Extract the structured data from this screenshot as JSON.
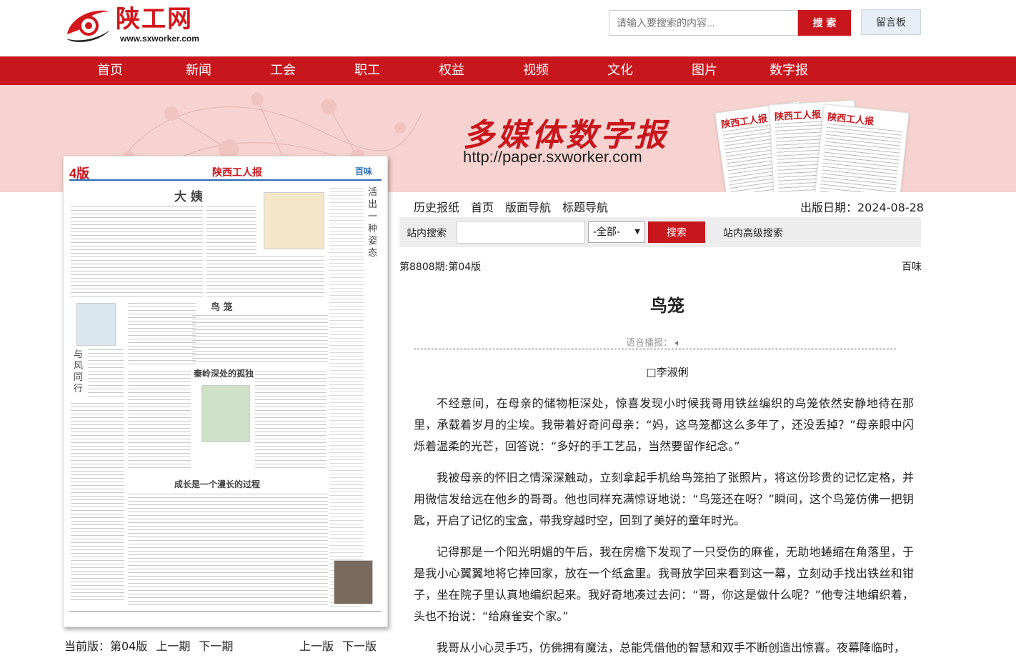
{
  "header": {
    "logo_text": "陕工网",
    "logo_url": "www.sxworker.com",
    "search_placeholder": "请输入要搜索的内容...",
    "search_button": "搜 索",
    "guestbook_button": "留言板"
  },
  "nav": {
    "items": [
      "首页",
      "新闻",
      "工会",
      "职工",
      "权益",
      "视频",
      "文化",
      "图片",
      "数字报"
    ]
  },
  "banner": {
    "title": "多媒体数字报",
    "url": "http://paper.sxworker.com",
    "paper_masthead": "陕西工人报"
  },
  "newspaper": {
    "page_number": "4版",
    "masthead": "陕西工人报",
    "section": "百味",
    "headline_1": "大 姨",
    "headline_2": "鸟 笼",
    "headline_3": "秦岭深处的孤独",
    "headline_4": "成长是一个漫长的过程",
    "side_column": "活出一种姿态",
    "vertical_title": "与风同行"
  },
  "page_nav": {
    "current_label": "当前版：第04版",
    "prev_issue": "上一期",
    "next_issue": "下一期",
    "prev_page": "上一版",
    "next_page": "下一版"
  },
  "tools": {
    "items": [
      "历史报纸",
      "首页",
      "版面导航",
      "标题导航"
    ],
    "pubdate": "出版日期：2024-08-28"
  },
  "sitebar": {
    "label": "站内搜索",
    "select_value": "-全部-",
    "button": "搜索",
    "advanced": "站内高级搜索"
  },
  "article": {
    "issue": "第8808期:第04版",
    "column": "百味",
    "title": "鸟笼",
    "tts_label": "语音播报：",
    "author": "□李淑俐",
    "paragraphs": [
      "不经意间，在母亲的储物柜深处，惊喜发现小时候我哥用铁丝编织的鸟笼依然安静地待在那里，承载着岁月的尘埃。我带着好奇问母亲：“妈，这鸟笼都这么多年了，还没丢掉？”母亲眼中闪烁着温柔的光芒，回答说：“多好的手工艺品，当然要留作纪念。”",
      "我被母亲的怀旧之情深深触动，立刻拿起手机给鸟笼拍了张照片，将这份珍贵的记忆定格，并用微信发给远在他乡的哥哥。他也同样充满惊讶地说：“鸟笼还在呀？”瞬间，这个鸟笼仿佛一把钥匙，开启了记忆的宝盒，带我穿越时空，回到了美好的童年时光。",
      "记得那是一个阳光明媚的午后，我在房檐下发现了一只受伤的麻雀，无助地蜷缩在角落里，于是我小心翼翼地将它捧回家，放在一个纸盒里。我哥放学回来看到这一幕，立刻动手找出铁丝和钳子，坐在院子里认真地编织起来。我好奇地凑过去问：“哥，你这是做什么呢？”他专注地编织着，头也不抬说：“给麻雀安个家。”",
      "我哥从小心灵手巧，仿佛拥有魔法，总能凭借他的智慧和双手不断创造出惊喜。夜幕降临时，"
    ]
  },
  "colors": {
    "brand_red": "#c8161d",
    "banner_pink": "#f6d3d0"
  }
}
